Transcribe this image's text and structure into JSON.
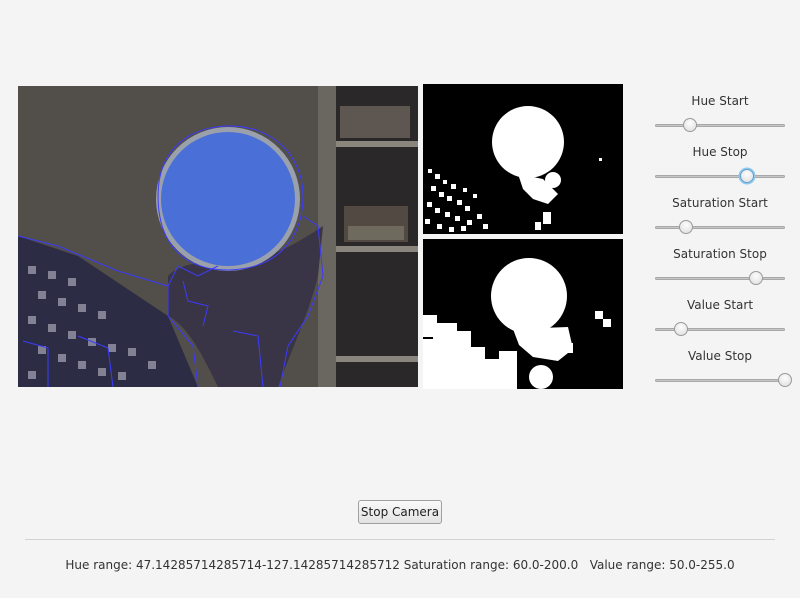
{
  "controls": {
    "sliders": [
      {
        "key": "hue_start",
        "label": "Hue Start",
        "fraction": 0.27,
        "focused": false
      },
      {
        "key": "hue_stop",
        "label": "Hue Stop",
        "fraction": 0.71,
        "focused": true
      },
      {
        "key": "saturation_start",
        "label": "Saturation Start",
        "fraction": 0.24,
        "focused": false
      },
      {
        "key": "saturation_stop",
        "label": "Saturation Stop",
        "fraction": 0.78,
        "focused": false
      },
      {
        "key": "value_start",
        "label": "Value Start",
        "fraction": 0.2,
        "focused": false
      },
      {
        "key": "value_stop",
        "label": "Value Stop",
        "fraction": 1.0,
        "focused": false
      }
    ]
  },
  "actions": {
    "stop_camera_label": "Stop Camera"
  },
  "status": {
    "hue_range": "Hue range: 47.14285714285714-127.14285714285712",
    "saturation_range": "Saturation range: 60.0-200.0",
    "value_range": "Value range: 50.0-255.0"
  },
  "colors": {
    "window_bg": "#f4f4f4",
    "contour": "#3b3bff",
    "mask_fg": "#ffffff",
    "mask_bg": "#000000",
    "thumb_focus": "#8fc7ec"
  }
}
